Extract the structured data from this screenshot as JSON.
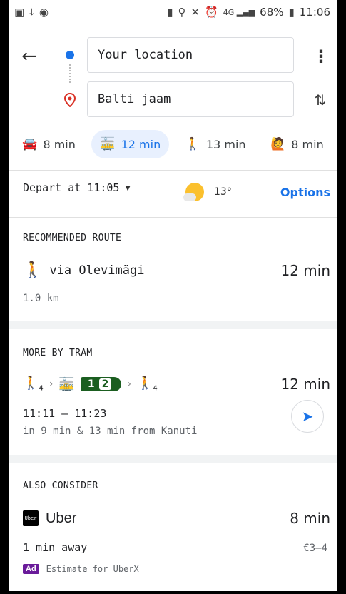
{
  "status_bar": {
    "left_icons": [
      "image-icon",
      "download-icon",
      "spotify-icon"
    ],
    "right_icons": [
      "battery-saver-icon",
      "location-icon",
      "mute-icon",
      "alarm-icon",
      "4g-icon",
      "signal-icon"
    ],
    "battery": "68%",
    "time": "11:06"
  },
  "header": {
    "from": "Your location",
    "to": "Balti jaam"
  },
  "modes": [
    {
      "icon": "car-icon",
      "glyph": "🚘",
      "label": "8 min"
    },
    {
      "icon": "tram-icon",
      "glyph": "🚋",
      "label": "12 min",
      "active": true
    },
    {
      "icon": "walk-icon",
      "glyph": "🚶",
      "label": "13 min"
    },
    {
      "icon": "ride-icon",
      "glyph": "🙋",
      "label": "8 min"
    }
  ],
  "depart": {
    "label": "Depart at 11:05",
    "temperature": "13°",
    "options": "Options"
  },
  "recommended": {
    "title": "RECOMMENDED ROUTE",
    "route": "via Olevimägi",
    "duration": "12 min",
    "distance": "1.0 km"
  },
  "tram": {
    "title": "MORE BY TRAM",
    "walk_sub": "4",
    "line1": "1",
    "line2": "2",
    "duration": "12 min",
    "time_range": "11:11 – 11:23",
    "detail": "in 9 min & 13 min from Kanuti"
  },
  "also": {
    "title": "ALSO CONSIDER",
    "logo_text": "Uber",
    "name": "Uber",
    "duration": "8 min",
    "away": "1 min away",
    "price": "€3–4",
    "ad_label": "Ad",
    "ad_text": "Estimate for UberX"
  }
}
